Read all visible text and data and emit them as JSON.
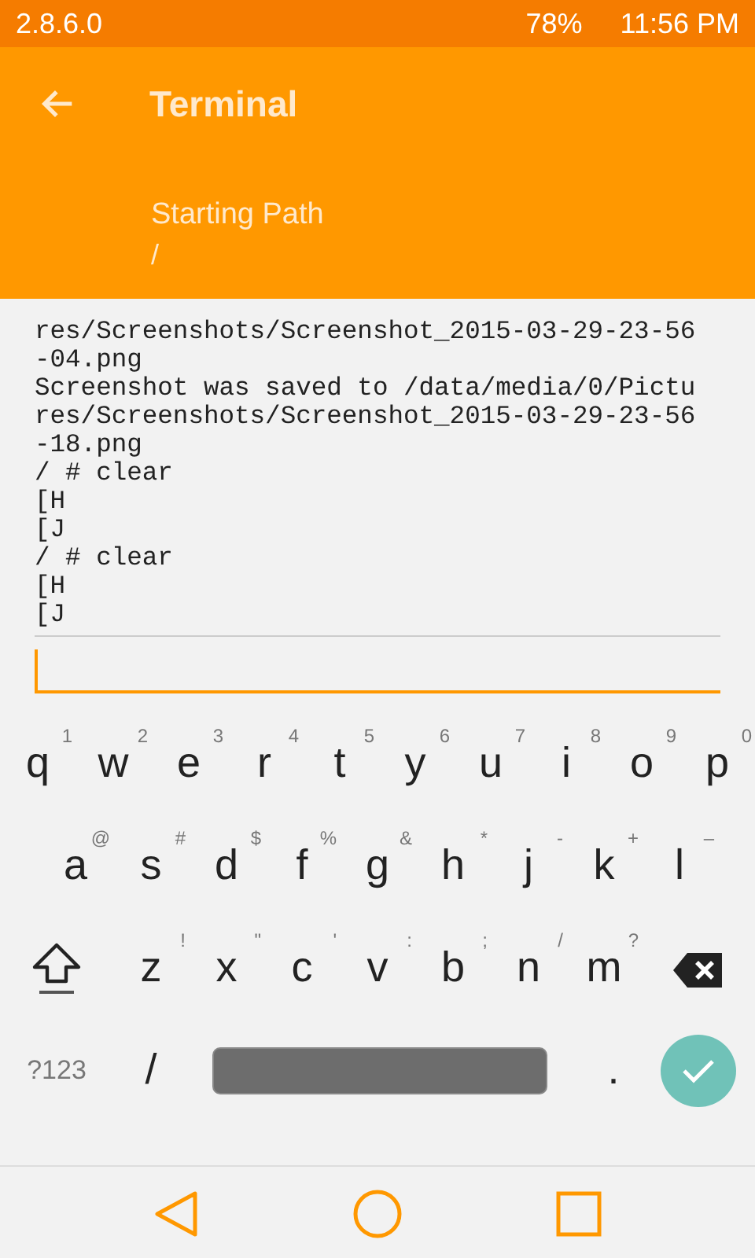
{
  "status_bar": {
    "version": "2.8.6.0",
    "battery": "78%",
    "time": "11:56 PM"
  },
  "app_bar": {
    "title": "Terminal",
    "subtitle_label": "Starting Path",
    "subtitle_value": "/"
  },
  "terminal": {
    "lines": [
      "res/Screenshots/Screenshot_2015-03-29-23-56",
      "-04.png",
      "Screenshot was saved to /data/media/0/Pictu",
      "res/Screenshots/Screenshot_2015-03-29-23-56",
      "-18.png",
      "/ # clear",
      "[H",
      "[J",
      "/ # clear",
      "[H",
      "[J"
    ]
  },
  "input": {
    "focused": true
  },
  "keyboard": {
    "letter_rows": [
      [
        {
          "kind": "char",
          "label": "q",
          "hint": "1"
        },
        {
          "kind": "char",
          "label": "w",
          "hint": "2"
        },
        {
          "kind": "char",
          "label": "e",
          "hint": "3"
        },
        {
          "kind": "char",
          "label": "r",
          "hint": "4"
        },
        {
          "kind": "char",
          "label": "t",
          "hint": "5"
        },
        {
          "kind": "char",
          "label": "y",
          "hint": "6"
        },
        {
          "kind": "char",
          "label": "u",
          "hint": "7"
        },
        {
          "kind": "char",
          "label": "i",
          "hint": "8"
        },
        {
          "kind": "char",
          "label": "o",
          "hint": "9"
        },
        {
          "kind": "char",
          "label": "p",
          "hint": "0"
        }
      ],
      [
        {
          "kind": "char",
          "label": "a",
          "hint": "@"
        },
        {
          "kind": "char",
          "label": "s",
          "hint": "#"
        },
        {
          "kind": "char",
          "label": "d",
          "hint": "$"
        },
        {
          "kind": "char",
          "label": "f",
          "hint": "%"
        },
        {
          "kind": "char",
          "label": "g",
          "hint": "&"
        },
        {
          "kind": "char",
          "label": "h",
          "hint": "*"
        },
        {
          "kind": "char",
          "label": "j",
          "hint": "-"
        },
        {
          "kind": "char",
          "label": "k",
          "hint": "+"
        },
        {
          "kind": "char",
          "label": "l",
          "hint": "–"
        }
      ],
      [
        {
          "kind": "shift"
        },
        {
          "kind": "char",
          "label": "z",
          "hint": "!"
        },
        {
          "kind": "char",
          "label": "x",
          "hint": "\""
        },
        {
          "kind": "char",
          "label": "c",
          "hint": "'"
        },
        {
          "kind": "char",
          "label": "v",
          "hint": ":"
        },
        {
          "kind": "char",
          "label": "b",
          "hint": ";"
        },
        {
          "kind": "char",
          "label": "n",
          "hint": "/"
        },
        {
          "kind": "char",
          "label": "m",
          "hint": "?"
        },
        {
          "kind": "backspace"
        }
      ]
    ],
    "bottom_row": [
      {
        "kind": "mode",
        "label": "?123"
      },
      {
        "kind": "char",
        "label": "/"
      },
      {
        "kind": "space"
      },
      {
        "kind": "char",
        "label": "."
      },
      {
        "kind": "enter"
      }
    ]
  }
}
